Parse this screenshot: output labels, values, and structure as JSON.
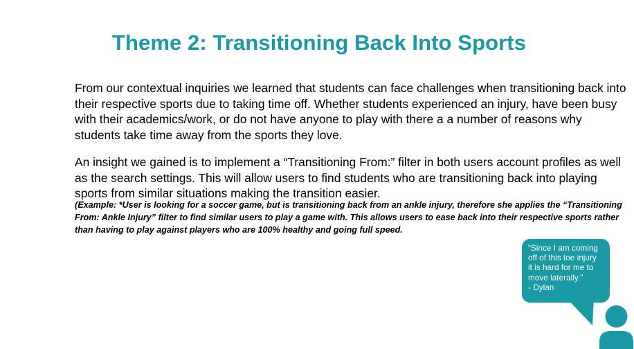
{
  "slide": {
    "title": "Theme 2: Transitioning Back Into Sports",
    "paragraph1": "From our contextual inquiries we learned that students can face challenges when transitioning back into their respective sports due to taking time off. Whether students experienced an injury, have been busy with their academics/work, or do not have anyone to play with there a a number of reasons why students take time away from the sports they love.",
    "paragraph2": "An insight we gained is to implement a “Transitioning From:” filter in both users account profiles as well as the search settings. This will allow users to find students who are transitioning back into playing sports from similar situations making the transition easier.",
    "example": "(Example: *User is looking for a soccer game, but is transitioning back from an ankle injury, therefore she applies the “Transitioning From: Ankle Injury” filter to find similar users to play a game with. This allows users to ease back into their respective sports rather than having to play against players who are 100% healthy and going full speed."
  },
  "quote": {
    "line1": "“Since I am coming",
    "line2": "off of this toe injury",
    "line3": "it is hard for me to",
    "line4": "move laterally.”",
    "line5": "- Dylan"
  },
  "icons": {
    "speaker": "person-icon",
    "bubble": "speech-bubble-icon"
  },
  "colors": {
    "accent": "#1a9aa5",
    "text": "#000000",
    "background": "#ffffff"
  }
}
